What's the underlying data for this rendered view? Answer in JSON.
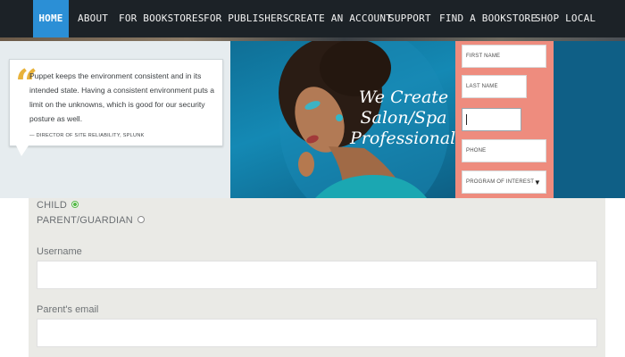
{
  "nav": {
    "items": [
      {
        "label": "HOME",
        "active": true
      },
      {
        "label": "ABOUT"
      },
      {
        "label": "FOR BOOKSTORES"
      },
      {
        "label": "FOR PUBLISHERS"
      },
      {
        "label": "CREATE AN ACCOUNT"
      },
      {
        "label": "SUPPORT"
      },
      {
        "label": "FIND A BOOKSTORE"
      },
      {
        "label": "SHOP LOCAL"
      }
    ]
  },
  "hero": {
    "quote": {
      "mark": "“",
      "text": "Puppet keeps the environment consistent and in its intended state. Having a consistent environment puts a limit on the unknowns, which is good for our security posture as well.",
      "attribution": "— DIRECTOR OF SITE RELIABILITY, SPLUNK"
    },
    "headline": [
      "We Create",
      "Salon/Spa",
      "Professionals"
    ],
    "lead_form": {
      "first_name": "FIRST NAME",
      "last_name": "LAST NAME",
      "phone": "PHONE",
      "program": "PROGRAM OF INTEREST",
      "select_arrow": "▼"
    }
  },
  "form": {
    "radios": [
      {
        "label": "CHILD",
        "checked": true
      },
      {
        "label": "PARENT/GUARDIAN",
        "checked": false
      }
    ],
    "username_label": "Username",
    "parent_email_label": "Parent's email"
  },
  "colors": {
    "nav_bg": "#1c2227",
    "nav_active": "#2b8fd6",
    "hero_blue": "#115f86",
    "form_panel": "#ee8c7e",
    "quote_mark": "#e8b23a",
    "radio_checked": "#58b94a",
    "lower_bg": "#eaeae6"
  }
}
